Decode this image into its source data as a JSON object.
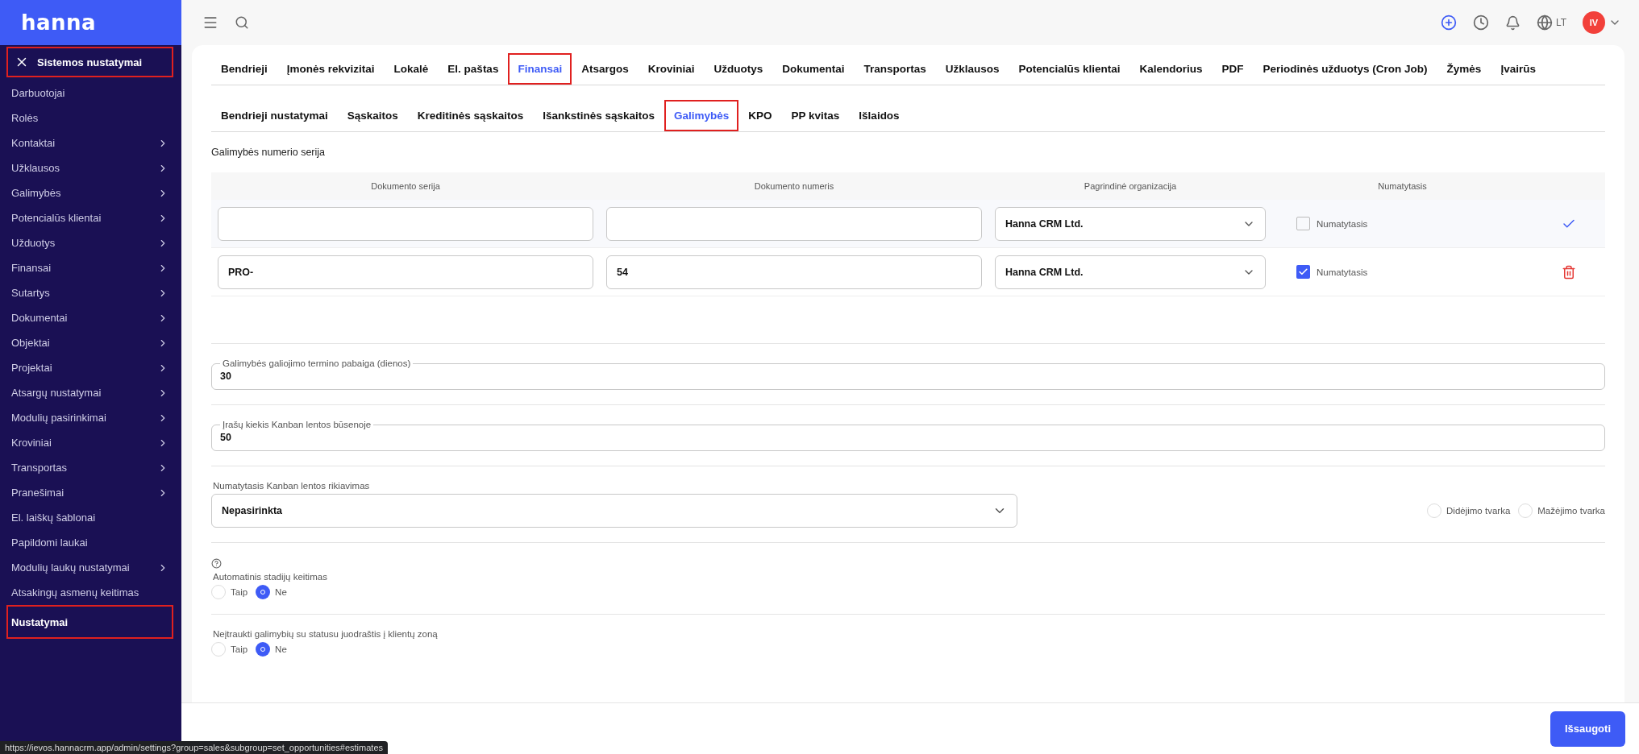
{
  "brand": {
    "logo": "hanna"
  },
  "sidebar": {
    "header": {
      "label": "Sistemos nustatymai",
      "annotated": true
    },
    "items": [
      {
        "label": "Darbuotojai",
        "has_submenu": false,
        "selected": false,
        "annotated": false
      },
      {
        "label": "Rolės",
        "has_submenu": false,
        "selected": false,
        "annotated": false
      },
      {
        "label": "Kontaktai",
        "has_submenu": true,
        "selected": false,
        "annotated": false
      },
      {
        "label": "Užklausos",
        "has_submenu": true,
        "selected": false,
        "annotated": false
      },
      {
        "label": "Galimybės",
        "has_submenu": true,
        "selected": false,
        "annotated": false
      },
      {
        "label": "Potencialūs klientai",
        "has_submenu": true,
        "selected": false,
        "annotated": false
      },
      {
        "label": "Užduotys",
        "has_submenu": true,
        "selected": false,
        "annotated": false
      },
      {
        "label": "Finansai",
        "has_submenu": true,
        "selected": false,
        "annotated": false
      },
      {
        "label": "Sutartys",
        "has_submenu": true,
        "selected": false,
        "annotated": false
      },
      {
        "label": "Dokumentai",
        "has_submenu": true,
        "selected": false,
        "annotated": false
      },
      {
        "label": "Objektai",
        "has_submenu": true,
        "selected": false,
        "annotated": false
      },
      {
        "label": "Projektai",
        "has_submenu": true,
        "selected": false,
        "annotated": false
      },
      {
        "label": "Atsargų nustatymai",
        "has_submenu": true,
        "selected": false,
        "annotated": false
      },
      {
        "label": "Modulių pasirinkimai",
        "has_submenu": true,
        "selected": false,
        "annotated": false
      },
      {
        "label": "Kroviniai",
        "has_submenu": true,
        "selected": false,
        "annotated": false
      },
      {
        "label": "Transportas",
        "has_submenu": true,
        "selected": false,
        "annotated": false
      },
      {
        "label": "Pranešimai",
        "has_submenu": true,
        "selected": false,
        "annotated": false
      },
      {
        "label": "El. laiškų šablonai",
        "has_submenu": false,
        "selected": false,
        "annotated": false
      },
      {
        "label": "Papildomi laukai",
        "has_submenu": false,
        "selected": false,
        "annotated": false
      },
      {
        "label": "Modulių laukų nustatymai",
        "has_submenu": true,
        "selected": false,
        "annotated": false
      },
      {
        "label": "Atsakingų asmenų keitimas",
        "has_submenu": false,
        "selected": false,
        "annotated": false
      },
      {
        "label": "Nustatymai",
        "has_submenu": false,
        "selected": true,
        "annotated": true
      }
    ]
  },
  "topbar": {
    "language": "LT",
    "avatar": "IV"
  },
  "tabs": [
    {
      "label": "Bendrieji",
      "selected": false,
      "annotated": false
    },
    {
      "label": "Įmonės rekvizitai",
      "selected": false,
      "annotated": false
    },
    {
      "label": "Lokalė",
      "selected": false,
      "annotated": false
    },
    {
      "label": "El. paštas",
      "selected": false,
      "annotated": false
    },
    {
      "label": "Finansai",
      "selected": true,
      "annotated": true
    },
    {
      "label": "Atsargos",
      "selected": false,
      "annotated": false
    },
    {
      "label": "Kroviniai",
      "selected": false,
      "annotated": false
    },
    {
      "label": "Užduotys",
      "selected": false,
      "annotated": false
    },
    {
      "label": "Dokumentai",
      "selected": false,
      "annotated": false
    },
    {
      "label": "Transportas",
      "selected": false,
      "annotated": false
    },
    {
      "label": "Užklausos",
      "selected": false,
      "annotated": false
    },
    {
      "label": "Potencialūs klientai",
      "selected": false,
      "annotated": false
    },
    {
      "label": "Kalendorius",
      "selected": false,
      "annotated": false
    },
    {
      "label": "PDF",
      "selected": false,
      "annotated": false
    },
    {
      "label": "Periodinės užduotys (Cron Job)",
      "selected": false,
      "annotated": false
    },
    {
      "label": "Žymės",
      "selected": false,
      "annotated": false
    },
    {
      "label": "Įvairūs",
      "selected": false,
      "annotated": false
    }
  ],
  "subtabs": [
    {
      "label": "Bendrieji nustatymai",
      "selected": false,
      "annotated": false
    },
    {
      "label": "Sąskaitos",
      "selected": false,
      "annotated": false
    },
    {
      "label": "Kreditinės sąskaitos",
      "selected": false,
      "annotated": false
    },
    {
      "label": "Išankstinės sąskaitos",
      "selected": false,
      "annotated": false
    },
    {
      "label": "Galimybės",
      "selected": true,
      "annotated": true
    },
    {
      "label": "KPO",
      "selected": false,
      "annotated": false
    },
    {
      "label": "PP kvitas",
      "selected": false,
      "annotated": false
    },
    {
      "label": "Išlaidos",
      "selected": false,
      "annotated": false
    }
  ],
  "series_section": {
    "title": "Galimybės numerio serija",
    "columns": [
      "Dokumento serija",
      "Dokumento numeris",
      "Pagrindinė organizacija",
      "Numatytasis"
    ],
    "rows": [
      {
        "kind": "new",
        "organization": "Hanna CRM Ltd.",
        "default_label": "Numatytasis",
        "checked": false
      },
      {
        "kind": "existing",
        "series": "PRO-",
        "number": "54",
        "organization": "Hanna CRM Ltd.",
        "default_label": "Numatytasis",
        "checked": true
      }
    ]
  },
  "fields": [
    {
      "label": "Galimybės galiojimo termino pabaiga (dienos)",
      "value": "30"
    },
    {
      "label": "Įrašų kiekis Kanban lentos būsenoje",
      "value": "50"
    }
  ],
  "sorting": {
    "label": "Numatytasis Kanban lentos rikiavimas",
    "value": "Nepasirinkta",
    "options": [
      {
        "label": "Didėjimo tvarka",
        "selected": false
      },
      {
        "label": "Mažėjimo tvarka",
        "selected": false
      }
    ]
  },
  "toggles": [
    {
      "label": "Automatinis stadijų keitimas",
      "help": true,
      "options": [
        {
          "label": "Taip",
          "selected": false
        },
        {
          "label": "Ne",
          "selected": true
        }
      ]
    },
    {
      "label": "Neįtraukti galimybių su statusu juodraštis į klientų zoną",
      "help": false,
      "options": [
        {
          "label": "Taip",
          "selected": false
        },
        {
          "label": "Ne",
          "selected": true
        }
      ]
    }
  ],
  "save_button": "Išsaugoti",
  "status_bar": "https://ievos.hannacrm.app/admin/settings?group=sales&subgroup=set_opportunities#estimates"
}
